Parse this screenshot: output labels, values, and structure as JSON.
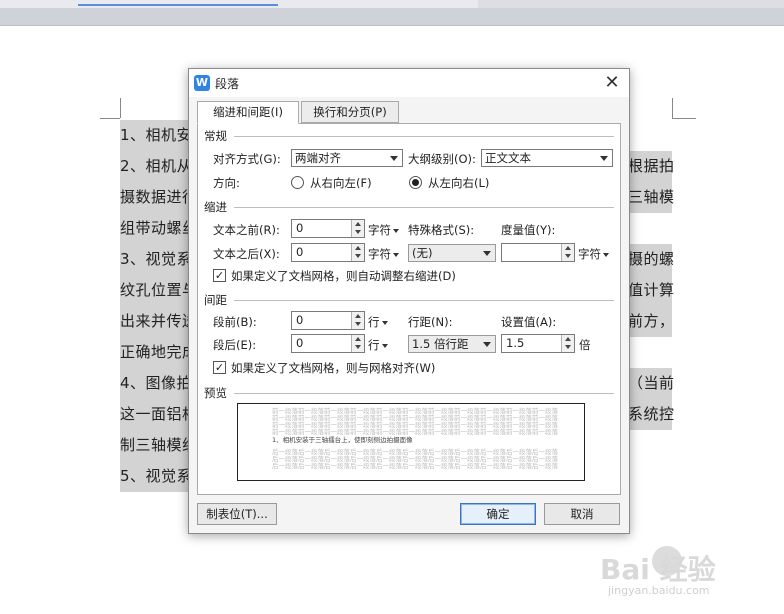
{
  "document": {
    "left_lines": [
      "1、相机安",
      "2、相机从",
      "摄数据进行",
      "组带动螺丝",
      "3、视觉系",
      "纹孔位置与",
      "出来并传送",
      "正确地完成",
      "4、图像拍",
      "这一面铝相",
      "制三轴模组",
      "5、视觉系"
    ],
    "right_lines": [
      "根据拍",
      "三轴模",
      "摄的螺",
      "值计算",
      "前方，",
      "（当前",
      "系统控"
    ]
  },
  "watermark": {
    "brand": "Bai 经验",
    "sub": "jingyan.baidu.com"
  },
  "dialog": {
    "title": "段落",
    "app_icon_letter": "W",
    "close_glyph": "✕",
    "tabs": [
      "缩进和间距(I)",
      "换行和分页(P)"
    ],
    "sections": {
      "general": "常规",
      "indent": "缩进",
      "spacing": "间距",
      "preview": "预览"
    },
    "general": {
      "align_label": "对齐方式(G):",
      "align_value": "两端对齐",
      "outline_label": "大纲级别(O):",
      "outline_value": "正文文本",
      "direction_label": "方向:",
      "rtl_label": "从右向左(F)",
      "ltr_label": "从左向右(L)"
    },
    "indent": {
      "before_label": "文本之前(R):",
      "before_value": "0",
      "before_unit": "字符",
      "after_label": "文本之后(X):",
      "after_value": "0",
      "after_unit": "字符",
      "special_label": "特殊格式(S):",
      "special_value": "(无)",
      "measure_label": "度量值(Y):",
      "measure_value": "",
      "measure_unit": "字符",
      "auto_adjust_label": "如果定义了文档网格，则自动调整右缩进(D)"
    },
    "spacing": {
      "before_label": "段前(B):",
      "before_value": "0",
      "before_unit": "行",
      "after_label": "段后(E):",
      "after_value": "0",
      "after_unit": "行",
      "line_label": "行距(N):",
      "line_value": "1.5 倍行距",
      "setting_label": "设置值(A):",
      "setting_value": "1.5",
      "setting_unit": "倍",
      "grid_align_label": "如果定义了文档网格，则与网格对齐(W)"
    },
    "preview": {
      "prev_line": "前一段落前一段落前一段落前一段落前一段落前一段落前一段落前一段落前一段落前一段落前一段落",
      "sample_line": "1、相机安装于三轴擂台上，使即刻侧边拍摄面像",
      "next_line": "后一段落后一段落后一段落后一段落后一段落后一段落后一段落后一段落后一段落后一段落后一段落"
    },
    "buttons": {
      "tabs": "制表位(T)...",
      "ok": "确定",
      "cancel": "取消"
    }
  }
}
